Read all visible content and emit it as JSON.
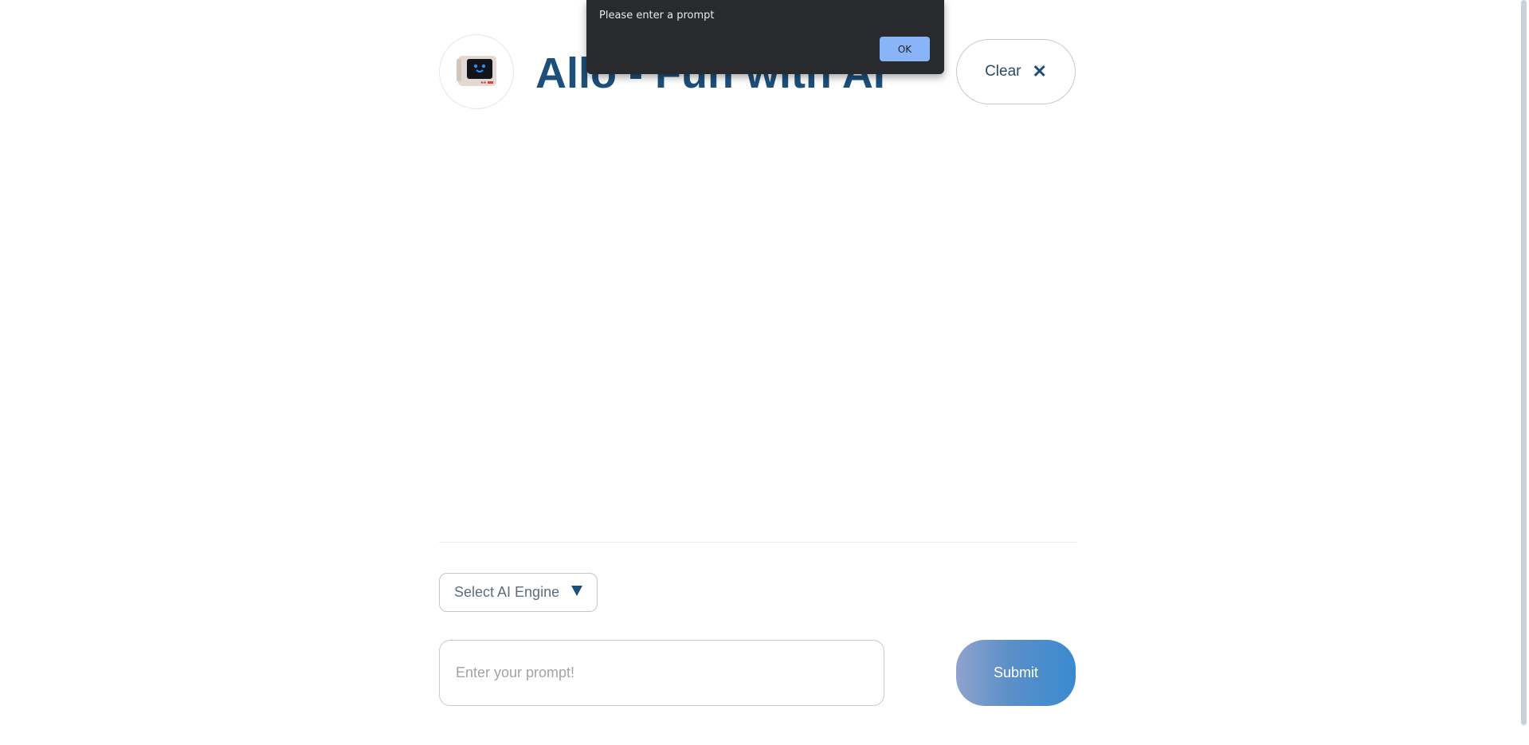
{
  "header": {
    "logo_icon": "robot-icon",
    "title": "Allo - Fun with AI",
    "clear_label": "Clear",
    "clear_icon_glyph": "✕"
  },
  "engine_select": {
    "selected": "Select AI Engine",
    "caret_icon": "caret-down-icon"
  },
  "prompt": {
    "value": "",
    "placeholder": "Enter your prompt!"
  },
  "submit_label": "Submit",
  "alert": {
    "message": "Please enter a prompt",
    "ok_label": "OK"
  },
  "colors": {
    "title": "#1c4f7a",
    "alert_bg": "#292a2d",
    "alert_button": "#8ab4f8",
    "submit_gradient_start": "#8fa3cc",
    "submit_gradient_end": "#3a8ad0"
  }
}
